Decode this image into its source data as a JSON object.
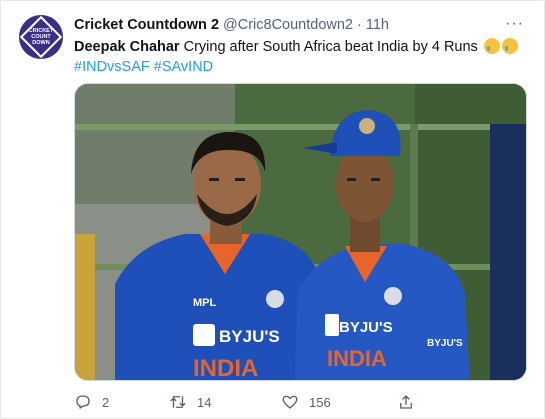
{
  "tweet": {
    "author_name": "Cricket Countdown 2",
    "handle": "@Cric8Countdown2",
    "separator": "·",
    "time": "11h",
    "more_label": "···",
    "avatar_text": "CRICKET COUNT DOWN",
    "text_bold": "Deepak Chahar",
    "text_rest": " Crying after South Africa beat India by 4 Runs",
    "hashtags": [
      "#INDvsSAF",
      "#SAvIND"
    ],
    "emojis": [
      "crying-face",
      "crying-face"
    ]
  },
  "image": {
    "jersey_sponsor": "BYJU'S",
    "jersey_country": "INDIA",
    "jersey_kit": "MPL",
    "jersey_sleeve": "BYJU'S"
  },
  "actions": {
    "replies": "2",
    "retweets": "14",
    "likes": "156"
  },
  "colors": {
    "accent": "#1d9bf0",
    "jersey_blue": "#1f4fb8",
    "jersey_orange": "#e8652a",
    "avatar_bg": "#3a2e86"
  }
}
